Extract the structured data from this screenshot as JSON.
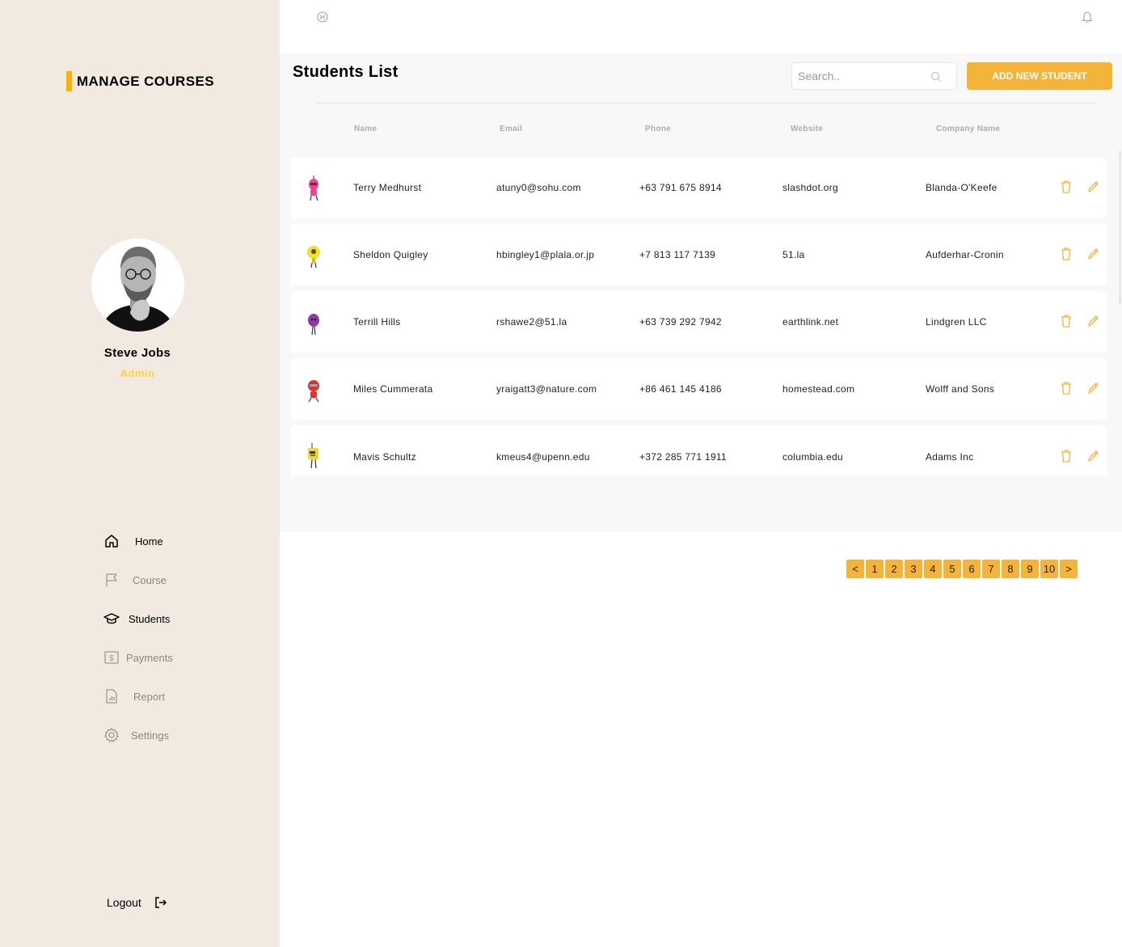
{
  "brand": {
    "title": "MANAGE COURSES",
    "accent_color": "#feaf00"
  },
  "user": {
    "name": "Steve Jobs",
    "role": "Admin",
    "role_color": "#f8d442"
  },
  "nav": {
    "items": [
      {
        "label": "Home",
        "icon": "home-icon",
        "active": true
      },
      {
        "label": "Course",
        "icon": "flag-icon",
        "active": false
      },
      {
        "label": "Students",
        "icon": "graduation-cap-icon",
        "active": true
      },
      {
        "label": "Payments",
        "icon": "dollar-icon",
        "active": false
      },
      {
        "label": "Report",
        "icon": "report-icon",
        "active": false
      },
      {
        "label": "Settings",
        "icon": "gear-icon",
        "active": false
      }
    ],
    "logout_label": "Logout"
  },
  "topbar": {
    "back_icon": "circle-back-icon",
    "bell_icon": "bell-icon"
  },
  "main": {
    "title": "Students List",
    "search_placeholder": "Search..",
    "add_button_label": "ADD NEW STUDENT",
    "accent_color": "#f4b43a"
  },
  "table": {
    "columns": [
      "Name",
      "Email",
      "Phone",
      "Website",
      "Company Name"
    ],
    "rows": [
      {
        "name": "Terry Medhurst",
        "email": "atuny0@sohu.com",
        "phone": "+63 791 675 8914",
        "website": "slashdot.org",
        "company": "Blanda-O'Keefe",
        "avatar_color": "#e8468f"
      },
      {
        "name": "Sheldon Quigley",
        "email": "hbingley1@plala.or.jp",
        "phone": "+7 813 117 7139",
        "website": "51.la",
        "company": "Aufderhar-Cronin",
        "avatar_color": "#f2e12a"
      },
      {
        "name": "Terrill Hills",
        "email": "rshawe2@51.la",
        "phone": "+63 739 292 7942",
        "website": "earthlink.net",
        "company": "Lindgren LLC",
        "avatar_color": "#8d3aa8"
      },
      {
        "name": "Miles Cummerata",
        "email": "yraigatt3@nature.com",
        "phone": "+86 461 145 4186",
        "website": "homestead.com",
        "company": "Wolff and Sons",
        "avatar_color": "#e2332b"
      },
      {
        "name": "Mavis Schultz",
        "email": "kmeus4@upenn.edu",
        "phone": "+372 285 771 1911",
        "website": "columbia.edu",
        "company": "Adams Inc",
        "avatar_color": "#ecd537"
      }
    ]
  },
  "pagination": {
    "pages": [
      "<",
      "1",
      "2",
      "3",
      "4",
      "5",
      "6",
      "7",
      "8",
      "9",
      "10",
      ">"
    ]
  }
}
